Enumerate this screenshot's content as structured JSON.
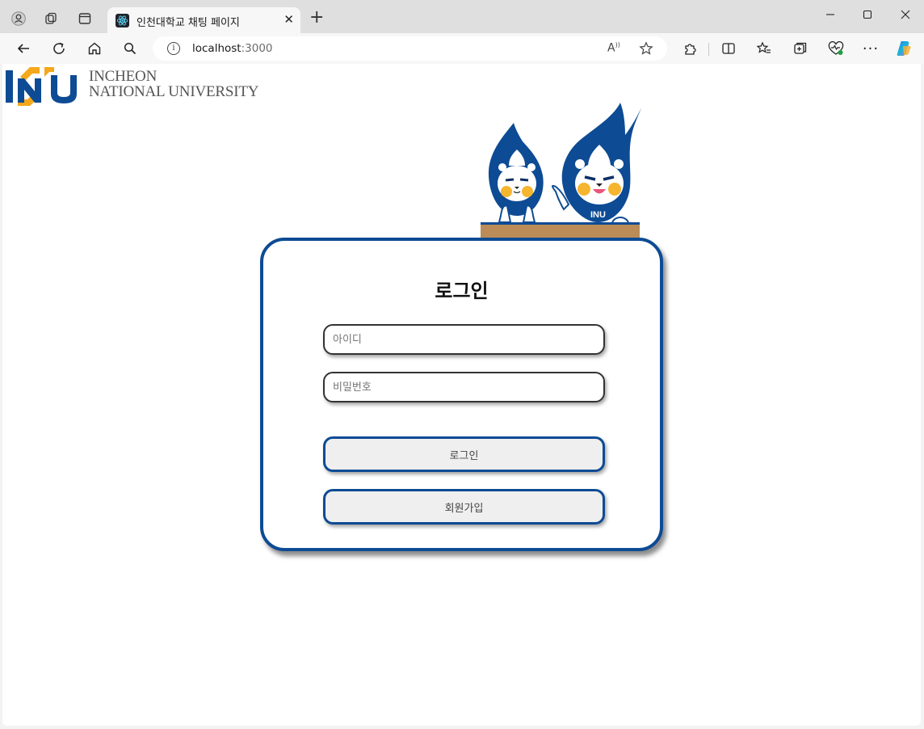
{
  "browser": {
    "tab_title": "인천대학교 채팅 페이지",
    "url_host": "localhost",
    "url_port": ":3000"
  },
  "logo": {
    "line1": "INCHEON",
    "line2": "NATIONAL UNIVERSITY",
    "colors": {
      "blue": "#0d4b94",
      "orange": "#f5a81c"
    }
  },
  "login": {
    "title": "로그인",
    "id_placeholder": "아이디",
    "password_placeholder": "비밀번호",
    "login_button": "로그인",
    "signup_button": "회원가입"
  },
  "theme": {
    "accent": "#0d4b94",
    "desk": "#bb8c57"
  }
}
